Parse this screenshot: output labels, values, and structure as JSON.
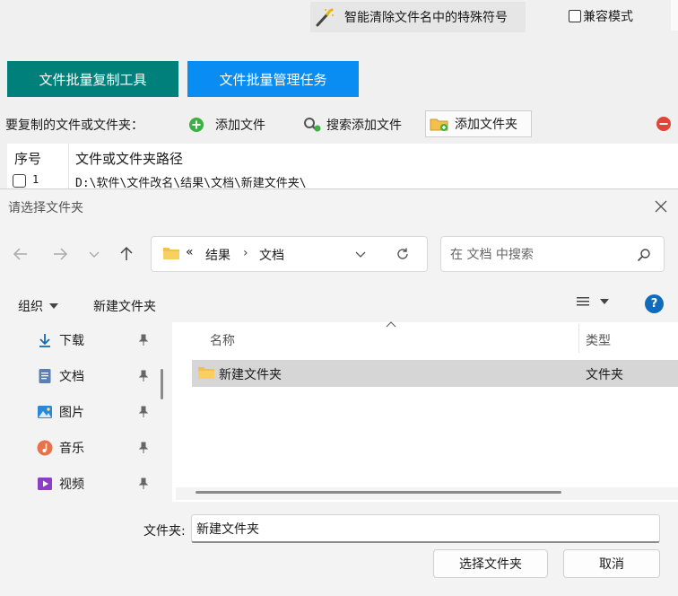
{
  "app": {
    "clean_button": "智能清除文件名中的特殊符号",
    "compat_label": "兼容模式",
    "tabs": [
      {
        "label": "文件批量复制工具",
        "color": "#00807a"
      },
      {
        "label": "文件批量管理任务",
        "color": "#0a8df2"
      }
    ],
    "files_label": "要复制的文件或文件夹：",
    "toolbar": {
      "add_file": "添加文件",
      "search_add": "搜索添加文件",
      "add_folder": "添加文件夹"
    },
    "table": {
      "headers": [
        "序号",
        "文件或文件夹路径"
      ],
      "rows": [
        {
          "num": "1",
          "path": "D:\\软件\\文件改名\\结果\\文档\\新建文件夹\\"
        }
      ]
    }
  },
  "dialog": {
    "title": "请选择文件夹",
    "address": {
      "overflow": "«",
      "crumbs": [
        "结果",
        "文档"
      ],
      "separator": "›"
    },
    "search_placeholder": "在 文档 中搜索",
    "commands": {
      "organize": "组织",
      "new_folder": "新建文件夹",
      "help": "?"
    },
    "nav_items": [
      {
        "label": "下载",
        "icon": "download-icon"
      },
      {
        "label": "文档",
        "icon": "document-icon"
      },
      {
        "label": "图片",
        "icon": "picture-icon"
      },
      {
        "label": "音乐",
        "icon": "music-icon"
      },
      {
        "label": "视频",
        "icon": "video-icon"
      }
    ],
    "columns": {
      "name": "名称",
      "type": "类型"
    },
    "items": [
      {
        "name": "新建文件夹",
        "type": "文件夹"
      }
    ],
    "folder_label": "文件夹:",
    "folder_value": "新建文件夹",
    "select_button": "选择文件夹",
    "cancel_button": "取消",
    "accent": "#0f6cbd",
    "folder_color": "#f4c04d"
  }
}
